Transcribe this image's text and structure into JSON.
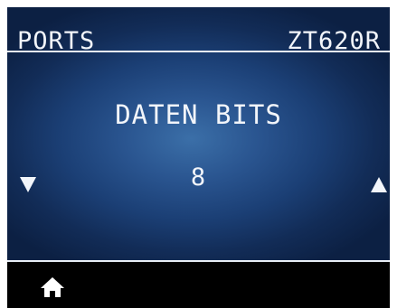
{
  "header": {
    "menu_title": "PORTS",
    "printer_model": "ZT620R"
  },
  "setting": {
    "name": "DATEN BITS",
    "value": "8"
  },
  "controls": {
    "previous_icon": "triangle-down-icon",
    "next_icon": "triangle-up-icon",
    "home_icon": "home-icon"
  },
  "colors": {
    "background_center": "#3b6fa8",
    "background_edge": "#0c2043",
    "text": "#f2f5fa",
    "footer": "#000000"
  }
}
